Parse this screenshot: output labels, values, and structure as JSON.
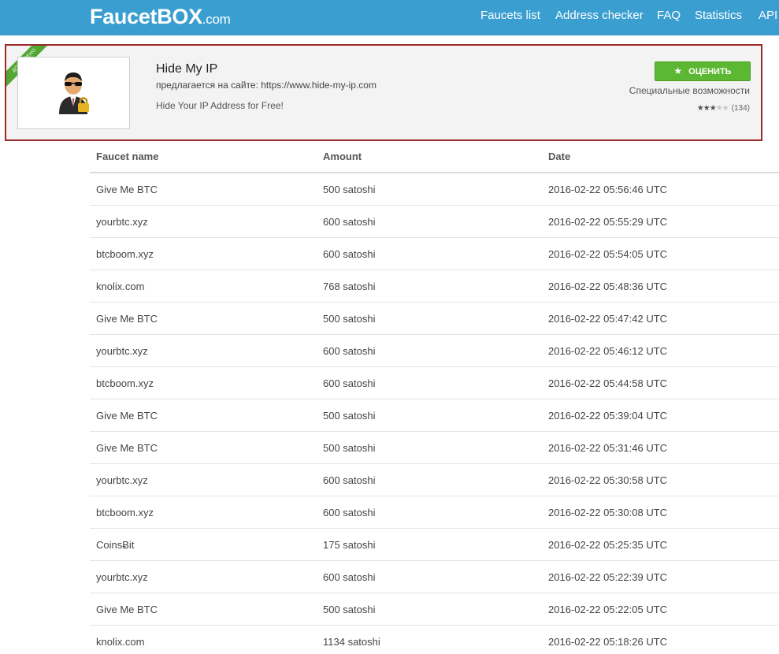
{
  "brand": {
    "name": "FaucetBOX",
    "suffix": ".com"
  },
  "nav": [
    "Faucets list",
    "Address checker",
    "FAQ",
    "Statistics",
    "API"
  ],
  "ad": {
    "ribbon": "ДОБАВЛЕНО",
    "title": "Hide My IP",
    "site": "предлагается на сайте: https://www.hide-my-ip.com",
    "description": "Hide Your IP Address for Free!",
    "button_label": "ОЦЕНИТЬ",
    "special": "Специальные возможности",
    "rating": 3,
    "rating_max": 5,
    "rating_count": "(134)"
  },
  "table": {
    "headers": [
      "Faucet name",
      "Amount",
      "Date"
    ],
    "rows": [
      {
        "name": "Give Me BTC",
        "amount": "500 satoshi",
        "date": "2016-02-22 05:56:46",
        "tz": "UTC"
      },
      {
        "name": "yourbtc.xyz",
        "amount": "600 satoshi",
        "date": "2016-02-22 05:55:29",
        "tz": "UTC"
      },
      {
        "name": "btcboom.xyz",
        "amount": "600 satoshi",
        "date": "2016-02-22 05:54:05",
        "tz": "UTC"
      },
      {
        "name": "knolix.com",
        "amount": "768 satoshi",
        "date": "2016-02-22 05:48:36",
        "tz": "UTC"
      },
      {
        "name": "Give Me BTC",
        "amount": "500 satoshi",
        "date": "2016-02-22 05:47:42",
        "tz": "UTC"
      },
      {
        "name": "yourbtc.xyz",
        "amount": "600 satoshi",
        "date": "2016-02-22 05:46:12",
        "tz": "UTC"
      },
      {
        "name": "btcboom.xyz",
        "amount": "600 satoshi",
        "date": "2016-02-22 05:44:58",
        "tz": "UTC"
      },
      {
        "name": "Give Me BTC",
        "amount": "500 satoshi",
        "date": "2016-02-22 05:39:04",
        "tz": "UTC"
      },
      {
        "name": "Give Me BTC",
        "amount": "500 satoshi",
        "date": "2016-02-22 05:31:46",
        "tz": "UTC"
      },
      {
        "name": "yourbtc.xyz",
        "amount": "600 satoshi",
        "date": "2016-02-22 05:30:58",
        "tz": "UTC"
      },
      {
        "name": "btcboom.xyz",
        "amount": "600 satoshi",
        "date": "2016-02-22 05:30:08",
        "tz": "UTC"
      },
      {
        "name": "CoinsɃit",
        "amount": "175 satoshi",
        "date": "2016-02-22 05:25:35",
        "tz": "UTC"
      },
      {
        "name": "yourbtc.xyz",
        "amount": "600 satoshi",
        "date": "2016-02-22 05:22:39",
        "tz": "UTC"
      },
      {
        "name": "Give Me BTC",
        "amount": "500 satoshi",
        "date": "2016-02-22 05:22:05",
        "tz": "UTC"
      },
      {
        "name": "knolix.com",
        "amount": "1134 satoshi",
        "date": "2016-02-22 05:18:26",
        "tz": "UTC"
      }
    ]
  }
}
